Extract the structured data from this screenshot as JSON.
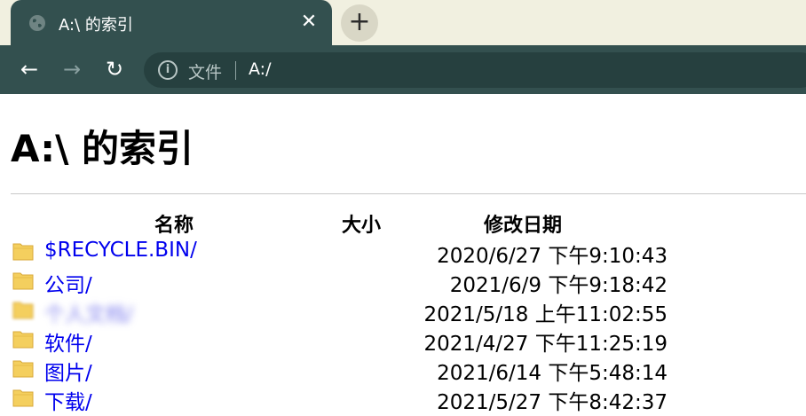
{
  "tab": {
    "title": "A:\\ 的索引",
    "close": "✕"
  },
  "newtab": {
    "label": "+"
  },
  "nav": {
    "back": "←",
    "forward": "→",
    "reload": "↻"
  },
  "omnibox": {
    "info_glyph": "i",
    "scheme_label": "文件",
    "url": "A:/"
  },
  "page": {
    "title": "A:\\ 的索引",
    "columns": {
      "name": "名称",
      "size": "大小",
      "date": "修改日期"
    },
    "rows": [
      {
        "name": "$RECYCLE.BIN/",
        "size": "",
        "date": "2020/6/27 下午9:10:43"
      },
      {
        "name": "公司/",
        "size": "",
        "date": "2021/6/9 下午9:18:42"
      },
      {
        "name": "个人文档/",
        "size": "",
        "date": "2021/5/18 上午11:02:55"
      },
      {
        "name": "软件/",
        "size": "",
        "date": "2021/4/27 下午11:25:19"
      },
      {
        "name": "图片/",
        "size": "",
        "date": "2021/6/14 下午5:48:14"
      },
      {
        "name": "下载/",
        "size": "",
        "date": "2021/5/27 下午8:42:37"
      }
    ]
  },
  "colors": {
    "chrome": "#33504f",
    "tabstrip": "#f1f0e0",
    "link": "#0000ee",
    "folder": "#f4cf5e"
  }
}
